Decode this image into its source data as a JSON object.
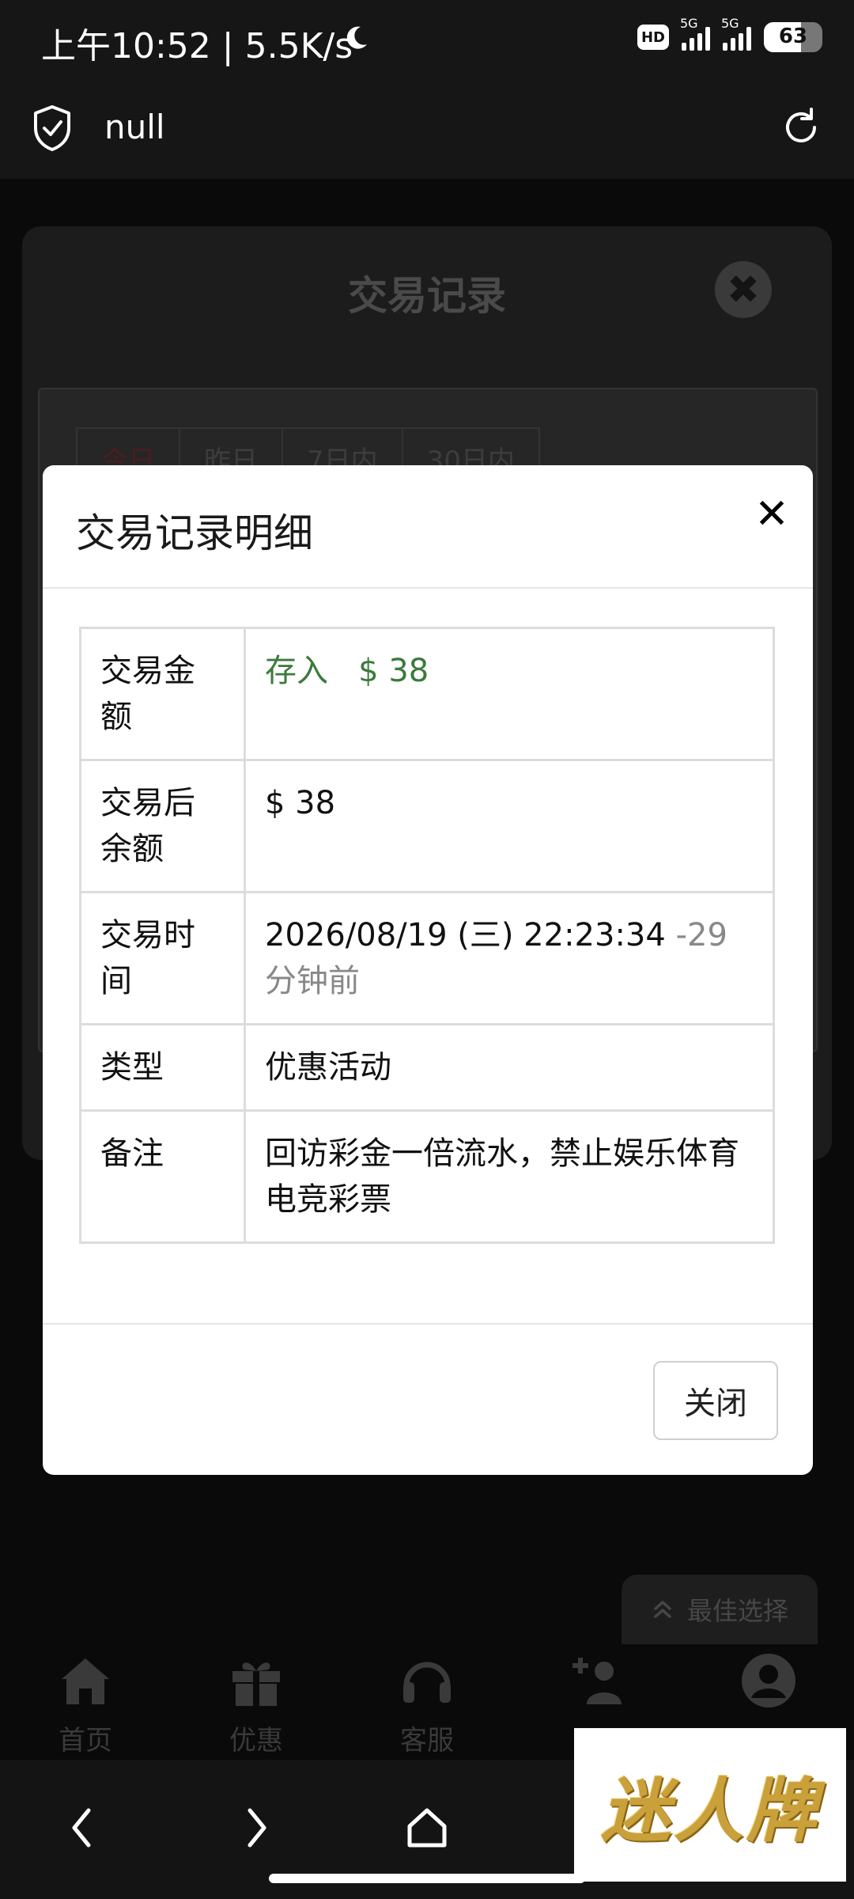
{
  "status_bar": {
    "time": "上午10:52 | 5.5K/s",
    "network_badge": "HD",
    "signal_1_label": "5G",
    "signal_2_label": "5G",
    "battery": "63",
    "moon_icon": "moon-icon"
  },
  "browser": {
    "url": "null",
    "shield_icon": "shield-check-icon",
    "reload_icon": "reload-icon"
  },
  "background_page": {
    "title": "交易记录",
    "tabs": [
      "今日",
      "昨日",
      "7日内",
      "30日内"
    ],
    "best_choice": "最佳选择",
    "bottom_nav": [
      {
        "label": "首页",
        "icon": "home-icon"
      },
      {
        "label": "优惠",
        "icon": "gift-icon"
      },
      {
        "label": "客服",
        "icon": "headset-icon"
      },
      {
        "label": "",
        "icon": "add-user-icon"
      },
      {
        "label": "",
        "icon": "user-icon"
      }
    ]
  },
  "modal": {
    "title": "交易记录明细",
    "rows": [
      {
        "key": "交易金额",
        "value_type": "存入",
        "value": "$ 38"
      },
      {
        "key": "交易后余额",
        "value": "$ 38"
      },
      {
        "key": "交易时间",
        "value": "2026/08/19 (三) 22:23:34",
        "value_extra": "-29 分钟前"
      },
      {
        "key": "类型",
        "value": "优惠活动"
      },
      {
        "key": "备注",
        "value": "回访彩金一倍流水，禁止娱乐体育电竞彩票"
      }
    ],
    "close_label": "关闭"
  },
  "brand": {
    "text": "迷人牌"
  },
  "colors": {
    "accent_green": "#3b7a3b",
    "modal_bg": "#ffffff",
    "page_bg": "#0b0b0b"
  }
}
